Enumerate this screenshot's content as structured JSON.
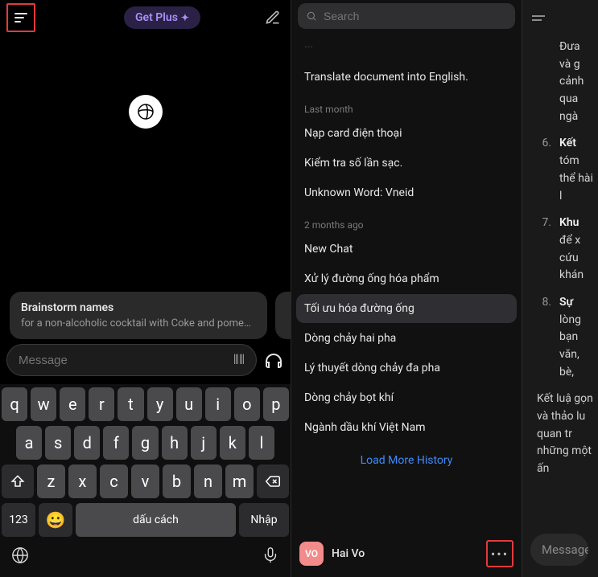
{
  "left": {
    "get_plus": "Get Plus",
    "suggestion": {
      "title": "Brainstorm names",
      "subtitle": "for a non-alcoholic cocktail with Coke and pomeg..."
    },
    "input_placeholder": "Message",
    "keyboard": {
      "row1": [
        "q",
        "w",
        "e",
        "r",
        "t",
        "y",
        "u",
        "i",
        "o",
        "p"
      ],
      "row2": [
        "a",
        "s",
        "d",
        "f",
        "g",
        "h",
        "j",
        "k",
        "l"
      ],
      "row3": [
        "z",
        "x",
        "c",
        "v",
        "b",
        "n",
        "m"
      ],
      "num": "123",
      "space": "dấu cách",
      "enter": "Nhập"
    }
  },
  "mid": {
    "search_placeholder": "Search",
    "top_cut_item": "Translate document into English.",
    "groups": [
      {
        "header": "Last month",
        "items": [
          "Nạp card điện thoại",
          "Kiểm tra số lần sạc.",
          "Unknown Word: Vneid"
        ]
      },
      {
        "header": "2 months ago",
        "items": [
          "New Chat",
          "Xử lý đường ống hóa phẩm",
          "Tối ưu hóa đường ống",
          "Dòng chảy hai pha",
          "Lý thuyết dòng chảy đa pha",
          "Dòng chảy bọt khí",
          "Ngành dầu khí Việt Nam"
        ]
      }
    ],
    "active_item": "Tối ưu hóa đường ống",
    "load_more": "Load More History",
    "account": {
      "initials": "VO",
      "name": "Hai Vo"
    }
  },
  "right": {
    "items": [
      {
        "num": "",
        "text": "Đưa và g cảnh qua ngà"
      },
      {
        "num": "6.",
        "bold": "Kết",
        "text": " tóm thể hài l"
      },
      {
        "num": "7.",
        "bold": "Khu",
        "text": " để x cứu khán"
      },
      {
        "num": "8.",
        "bold": "Sự",
        "text": " lòng bạn văn, bè,"
      }
    ],
    "conclusion": "Kết luậ gọn và thảo lu quan tr những một ấn",
    "input_placeholder": "Message"
  }
}
